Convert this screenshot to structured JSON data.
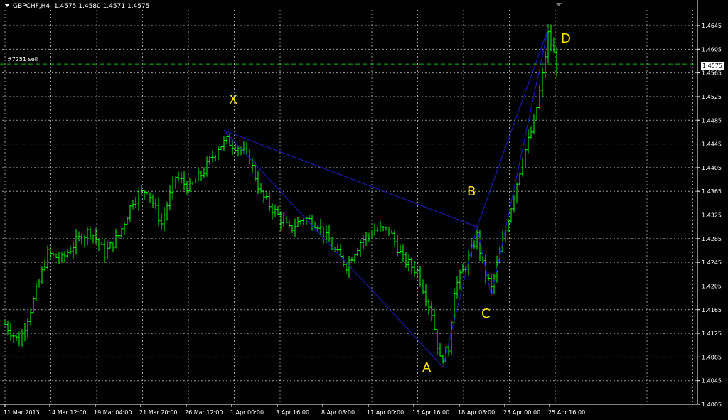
{
  "header": {
    "symbol": "GBPCHF,H4",
    "ohlc": "1.4575 1.4580 1.4571 1.4575"
  },
  "order_label": "#7251 sell",
  "current_price_label": "1.4575",
  "colors": {
    "background": "#000000",
    "grid": "#d9d9d9",
    "bars": "#00ff00",
    "pattern": "#1a1aa6",
    "labels": "#ffe600",
    "order_line": "#00c000"
  },
  "chart_data": {
    "type": "ohlc",
    "symbol": "GBPCHF",
    "timeframe": "H4",
    "ylim": [
      1.3995,
      1.4665
    ],
    "y_ticks": [
      "1.4645",
      "1.4605",
      "1.4565",
      "1.4525",
      "1.4485",
      "1.4445",
      "1.4405",
      "1.4365",
      "1.4325",
      "1.4285",
      "1.4245",
      "1.4205",
      "1.4165",
      "1.4125",
      "1.4085",
      "1.4045",
      "1.4005"
    ],
    "x_ticks": [
      "11 Mar 2013",
      "14 Mar 12:00",
      "19 Mar 04:00",
      "21 Mar 20:00",
      "26 Mar 12:00",
      "1 Apr 00:00",
      "3 Apr 16:00",
      "8 Apr 08:00",
      "11 Apr 00:00",
      "15 Apr 16:00",
      "18 Apr 08:00",
      "23 Apr 00:00",
      "25 Apr 16:00"
    ],
    "grid": true,
    "order_line": {
      "label": "#7251 sell",
      "price": 1.458
    },
    "current_price": 1.4575,
    "pattern_points": [
      {
        "label": "X",
        "bar": 77,
        "price": 1.4468
      },
      {
        "label": "A",
        "bar": 154,
        "price": 1.4068
      },
      {
        "label": "B",
        "bar": 166,
        "price": 1.4305
      },
      {
        "label": "C",
        "bar": 171,
        "price": 1.4188
      },
      {
        "label": "D",
        "bar": 191,
        "price": 1.464
      }
    ],
    "price_path": [
      [
        0,
        1.414
      ],
      [
        5,
        1.411
      ],
      [
        10,
        1.418
      ],
      [
        15,
        1.426
      ],
      [
        20,
        1.425
      ],
      [
        25,
        1.428
      ],
      [
        30,
        1.43
      ],
      [
        35,
        1.426
      ],
      [
        40,
        1.429
      ],
      [
        45,
        1.435
      ],
      [
        50,
        1.437
      ],
      [
        55,
        1.431
      ],
      [
        60,
        1.439
      ],
      [
        65,
        1.437
      ],
      [
        70,
        1.44
      ],
      [
        75,
        1.444
      ],
      [
        78,
        1.445
      ],
      [
        82,
        1.444
      ],
      [
        86,
        1.442
      ],
      [
        90,
        1.436
      ],
      [
        95,
        1.433
      ],
      [
        100,
        1.43
      ],
      [
        105,
        1.432
      ],
      [
        110,
        1.431
      ],
      [
        115,
        1.427
      ],
      [
        120,
        1.424
      ],
      [
        125,
        1.428
      ],
      [
        130,
        1.43
      ],
      [
        135,
        1.43
      ],
      [
        140,
        1.425
      ],
      [
        145,
        1.423
      ],
      [
        150,
        1.416
      ],
      [
        153,
        1.408
      ],
      [
        156,
        1.41
      ],
      [
        158,
        1.42
      ],
      [
        162,
        1.424
      ],
      [
        166,
        1.429
      ],
      [
        168,
        1.424
      ],
      [
        171,
        1.42
      ],
      [
        174,
        1.426
      ],
      [
        178,
        1.434
      ],
      [
        182,
        1.442
      ],
      [
        186,
        1.448
      ],
      [
        189,
        1.456
      ],
      [
        191,
        1.463
      ],
      [
        194,
        1.458
      ]
    ]
  }
}
